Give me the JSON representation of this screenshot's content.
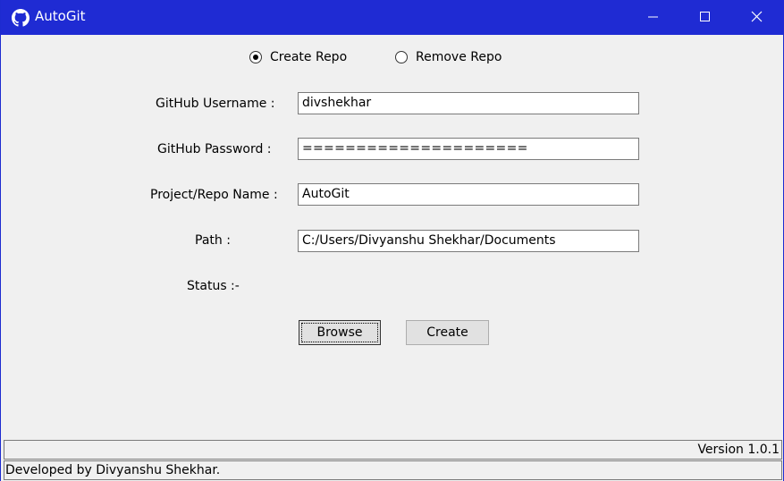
{
  "window": {
    "title": "AutoGit",
    "app_icon": "github-icon",
    "controls": [
      "minimize-icon",
      "maximize-icon",
      "close-icon"
    ],
    "titlebar_color": "#1f2bd3"
  },
  "mode": {
    "options": [
      {
        "label": "Create Repo",
        "selected": true
      },
      {
        "label": "Remove Repo",
        "selected": false
      }
    ]
  },
  "form": {
    "username_label": "GitHub Username :",
    "username_value": "divshekhar",
    "password_label": "GitHub Password :",
    "password_value": "=====================",
    "project_label": "Project/Repo Name :",
    "project_value": "AutoGit",
    "path_label": "Path :",
    "path_value": "C:/Users/Divyanshu Shekhar/Documents",
    "status_label": "Status :-"
  },
  "buttons": {
    "browse_label": "Browse",
    "create_label": "Create"
  },
  "footer": {
    "version": "Version 1.0.1",
    "developer": "Developed by Divyanshu Shekhar."
  }
}
